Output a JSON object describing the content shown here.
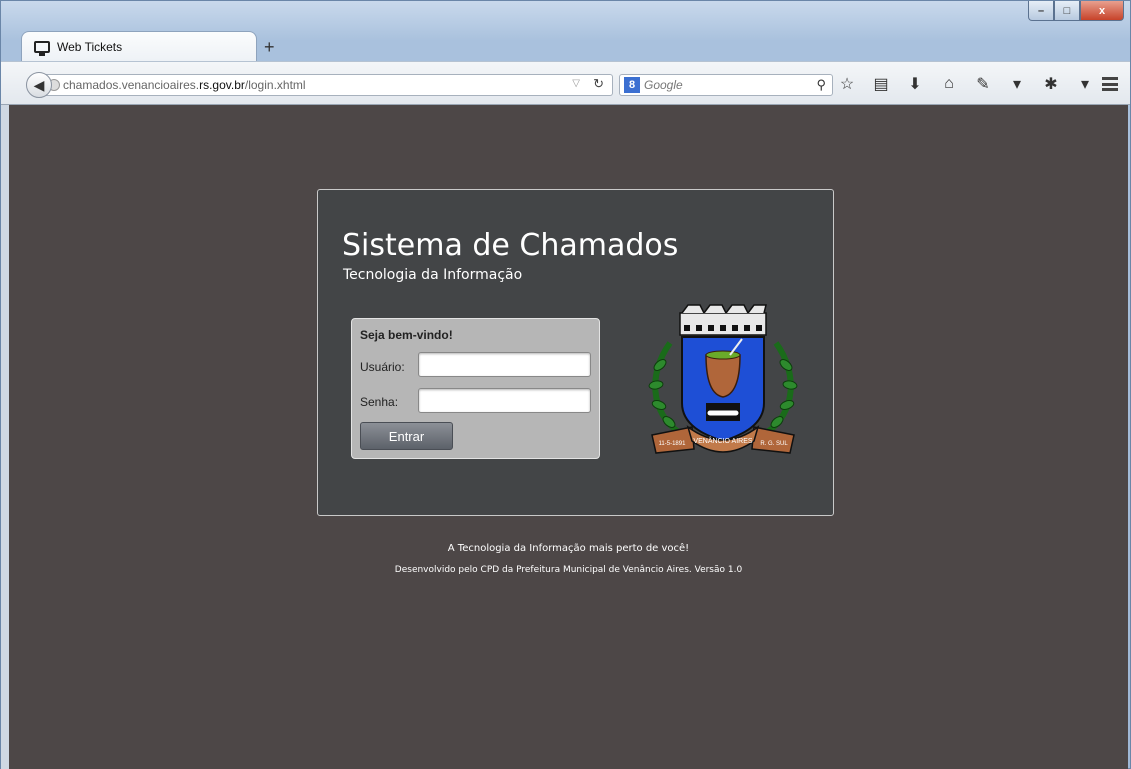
{
  "browser": {
    "tab_title": "Web Tickets",
    "new_tab": "+",
    "url_prefix": "chamados.venancioaires.",
    "url_domain": "rs.gov.br",
    "url_suffix": "/login.xhtml",
    "search_placeholder": "Google",
    "window_buttons": {
      "minimize": "–",
      "maximize": "□",
      "close": "x"
    }
  },
  "header": {
    "title": "Sistema de Chamados",
    "subtitle": "Tecnologia da Informação"
  },
  "login": {
    "welcome": "Seja bem-vindo!",
    "user_label": "Usuário:",
    "password_label": "Senha:",
    "user_value": "",
    "password_value": "",
    "submit_label": "Entrar"
  },
  "coat_of_arms": {
    "banner": "VENÂNCIO AIRES",
    "left_ribbon": "11-5-1891",
    "right_ribbon": "R. G. SUL"
  },
  "footer": {
    "tagline": "A Tecnologia da Informação mais perto de você!",
    "credits": "Desenvolvido pelo CPD da Prefeitura Municipal de Venâncio Aires. Versão 1.0"
  },
  "colors": {
    "page_background": "#4d4747",
    "panel_background": "#434547",
    "login_box": "#b6b6b6",
    "shield_blue": "#1e4fd6"
  }
}
